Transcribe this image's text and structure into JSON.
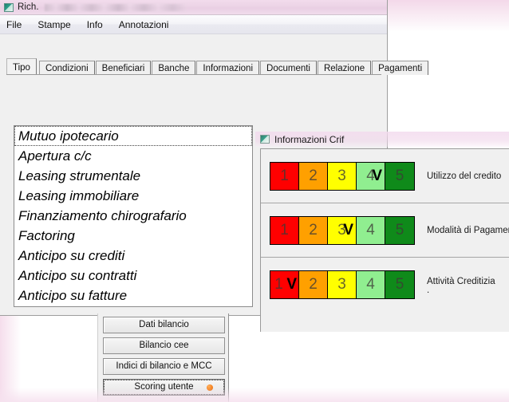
{
  "window": {
    "title": "Rich.",
    "title_redacted": true,
    "icon": "app-icon"
  },
  "menu": {
    "items": [
      {
        "label": "File"
      },
      {
        "label": "Stampe"
      },
      {
        "label": "Info"
      },
      {
        "label": "Annotazioni"
      }
    ]
  },
  "tabs": {
    "selected": "Tipo",
    "items": [
      {
        "label": "Tipo",
        "selected": true
      },
      {
        "label": "Condizioni",
        "selected": false
      },
      {
        "label": "Beneficiari",
        "selected": false
      },
      {
        "label": "Banche",
        "selected": false
      },
      {
        "label": "Informazioni",
        "selected": false
      },
      {
        "label": "Documenti",
        "selected": false
      },
      {
        "label": "Relazione",
        "selected": false
      },
      {
        "label": "Pagamenti",
        "selected": false
      }
    ]
  },
  "type_list": {
    "focused_index": 0,
    "items": [
      {
        "label": "Mutuo ipotecario"
      },
      {
        "label": "Apertura c/c"
      },
      {
        "label": "Leasing strumentale"
      },
      {
        "label": "Leasing immobiliare"
      },
      {
        "label": "Finanziamento chirografario"
      },
      {
        "label": "Factoring"
      },
      {
        "label": "Anticipo su crediti"
      },
      {
        "label": "Anticipo su contratti"
      },
      {
        "label": "Anticipo su fatture"
      }
    ]
  },
  "crif_window": {
    "title": "Informazioni Crif",
    "icon": "crif-icon",
    "scale_colors": [
      "#ff0000",
      "#ffa000",
      "#ffff00",
      "#90ee90",
      "#0f8a1a"
    ],
    "scale_values": [
      "1",
      "2",
      "3",
      "4",
      "5"
    ],
    "marker": "V",
    "groups": [
      {
        "label": "Utilizzo del credito",
        "marked_index": 3,
        "sub_text": ""
      },
      {
        "label": "Modalità di Pagamento",
        "marked_index": 2,
        "sub_text": ""
      },
      {
        "label": "Attività Creditizia",
        "marked_index": 0,
        "sub_text": "."
      }
    ]
  },
  "button_panel": {
    "buttons": [
      {
        "label": "Dati bilancio",
        "focused": false,
        "dot": false
      },
      {
        "label": "Bilancio cee",
        "focused": false,
        "dot": false
      },
      {
        "label": "Indici di bilancio e MCC",
        "focused": false,
        "dot": false
      },
      {
        "label": "Scoring utente",
        "focused": true,
        "dot": true,
        "dot_color": "#f58220"
      }
    ]
  }
}
